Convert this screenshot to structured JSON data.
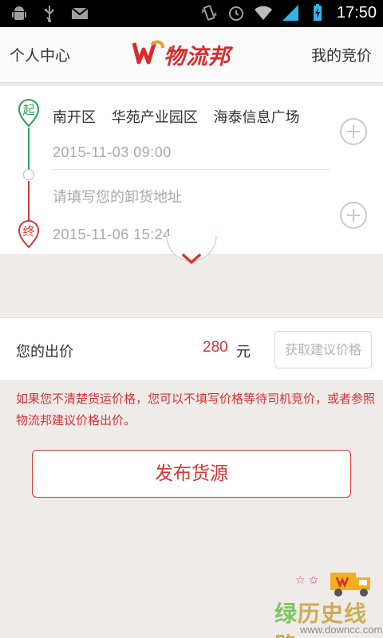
{
  "status_bar": {
    "time": "17:50",
    "icons": [
      "android-icon",
      "usb-icon",
      "gmail-icon",
      "vibrate-icon",
      "alarm-icon",
      "wifi-icon",
      "signal-icon",
      "battery-icon"
    ]
  },
  "header": {
    "left_label": "个人中心",
    "right_label": "我的竞价",
    "logo_text": "物流邦",
    "brand_color": "#d92b2b"
  },
  "route": {
    "start_pin_label": "起",
    "end_pin_label": "终",
    "start_address_parts": [
      "南开区",
      "华苑产业园区",
      "海泰信息广场"
    ],
    "start_time": "2015-11-03  09:00",
    "unload_placeholder": "请填写您的卸货地址",
    "end_time": "2015-11-06  15:24",
    "start_color": "#2e9e57",
    "end_color": "#cf3a3a"
  },
  "price": {
    "label": "您的出价",
    "value": "280",
    "unit": "元",
    "suggest_button": "获取建议价格"
  },
  "hint": "如果您不清楚货运价格，您可以不填写价格等待司机竞价，或者参照物流邦建议价格出价。",
  "publish_button": "发布货源",
  "watermark": {
    "text_a": "绿",
    "text_b": "历史线路",
    "url": "www.downcc.com"
  }
}
